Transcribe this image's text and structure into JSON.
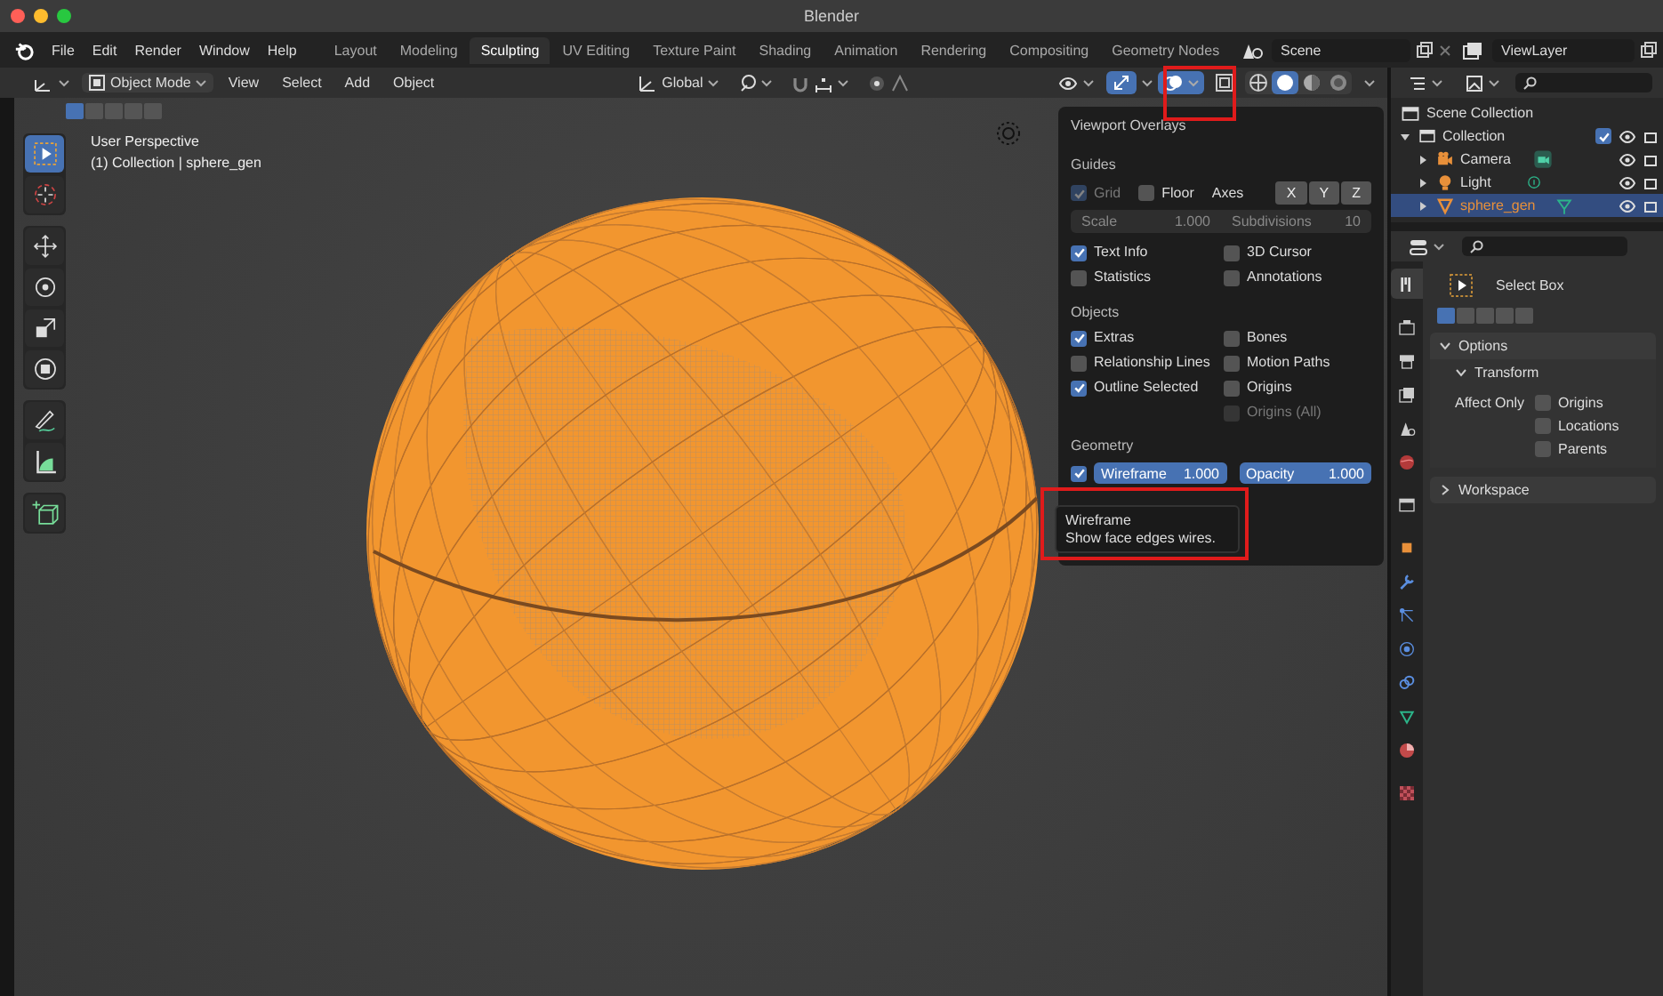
{
  "window": {
    "title": "Blender"
  },
  "menu": [
    "File",
    "Edit",
    "Render",
    "Window",
    "Help"
  ],
  "workspaces": [
    {
      "label": "Layout",
      "selected": false
    },
    {
      "label": "Modeling",
      "selected": false
    },
    {
      "label": "Sculpting",
      "selected": true
    },
    {
      "label": "UV Editing",
      "selected": false
    },
    {
      "label": "Texture Paint",
      "selected": false
    },
    {
      "label": "Shading",
      "selected": false
    },
    {
      "label": "Animation",
      "selected": false
    },
    {
      "label": "Rendering",
      "selected": false
    },
    {
      "label": "Compositing",
      "selected": false
    },
    {
      "label": "Geometry Nodes",
      "selected": false
    }
  ],
  "scene": {
    "name": "Scene"
  },
  "view_layer": {
    "name": "ViewLayer"
  },
  "header": {
    "mode": "Object Mode",
    "menus": [
      "View",
      "Select",
      "Add",
      "Object"
    ],
    "orientation": "Global",
    "gizmos_on": true,
    "overlays_on": true,
    "xray_on": false,
    "shading": [
      {
        "kind": "wireframe",
        "selected": false
      },
      {
        "kind": "solid",
        "selected": true
      },
      {
        "kind": "material",
        "selected": false
      },
      {
        "kind": "rendered",
        "selected": false
      }
    ]
  },
  "viewport": {
    "info": [
      "User Perspective",
      "(1) Collection | sphere_gen"
    ],
    "select_modes": [
      {
        "selected": true
      },
      {
        "selected": false
      },
      {
        "selected": false
      },
      {
        "selected": false
      },
      {
        "selected": false
      }
    ],
    "tool_groups": [
      [
        {
          "kind": "select_box",
          "selected": true
        },
        {
          "kind": "cursor",
          "selected": false
        }
      ],
      [
        {
          "kind": "move",
          "selected": false
        },
        {
          "kind": "rotate",
          "selected": false
        },
        {
          "kind": "scale",
          "selected": false
        },
        {
          "kind": "transform",
          "selected": false
        }
      ],
      [
        {
          "kind": "annotate",
          "selected": false
        },
        {
          "kind": "measure",
          "selected": false
        }
      ],
      [
        {
          "kind": "add_cube",
          "selected": false
        }
      ]
    ]
  },
  "overlays": {
    "title": "Viewport Overlays",
    "guides": {
      "heading": "Guides",
      "grid": {
        "label": "Grid",
        "checked": true,
        "disabled": true
      },
      "floor": {
        "label": "Floor",
        "checked": false,
        "disabled": false
      },
      "axes_label": "Axes",
      "axes": [
        "X",
        "Y",
        "Z"
      ],
      "scale": {
        "label": "Scale",
        "value": "1.000"
      },
      "subdivisions": {
        "label": "Subdivisions",
        "value": "10"
      },
      "options": [
        {
          "label": "Text Info",
          "checked": true,
          "disabled": false
        },
        {
          "label": "3D Cursor",
          "checked": false,
          "disabled": false
        },
        {
          "label": "Statistics",
          "checked": false,
          "disabled": false
        },
        {
          "label": "Annotations",
          "checked": false,
          "disabled": false
        }
      ]
    },
    "objects": {
      "heading": "Objects",
      "options": [
        {
          "label": "Extras",
          "checked": true,
          "disabled": false
        },
        {
          "label": "Bones",
          "checked": false,
          "disabled": false
        },
        {
          "label": "Relationship Lines",
          "checked": false,
          "disabled": false
        },
        {
          "label": "Motion Paths",
          "checked": false,
          "disabled": false
        },
        {
          "label": "Outline Selected",
          "checked": true,
          "disabled": false
        },
        {
          "label": "Origins",
          "checked": false,
          "disabled": false
        },
        {
          "label": "Origins (All)",
          "checked": false,
          "disabled": true
        }
      ]
    },
    "geometry": {
      "heading": "Geometry",
      "wireframe": {
        "checked": true,
        "label": "Wireframe",
        "value": "1.000",
        "level": 1
      },
      "opacity": {
        "label": "Opacity",
        "value": "1.000",
        "level": 1
      }
    }
  },
  "tooltip": {
    "title": "Wireframe",
    "text": "Show face edges wires."
  },
  "outliner": {
    "root": "Scene Collection",
    "items": [
      {
        "label": "Collection",
        "kind": "collection",
        "expanded": true,
        "checked": true,
        "selected": false,
        "children": [
          {
            "label": "Camera",
            "kind": "camera",
            "expanded": false,
            "selected": false
          },
          {
            "label": "Light",
            "kind": "light",
            "expanded": false,
            "selected": false
          },
          {
            "label": "sphere_gen",
            "kind": "mesh",
            "expanded": false,
            "selected": true
          }
        ]
      }
    ]
  },
  "properties": {
    "tabs": [
      {
        "kind": "tool",
        "selected": true
      },
      {
        "kind": "render",
        "selected": false
      },
      {
        "kind": "output",
        "selected": false
      },
      {
        "kind": "view_layer",
        "selected": false
      },
      {
        "kind": "scene",
        "selected": false
      },
      {
        "kind": "world",
        "selected": false
      },
      {
        "kind": "collection",
        "selected": false
      },
      {
        "kind": "object",
        "selected": false
      },
      {
        "kind": "modifiers",
        "selected": false
      },
      {
        "kind": "particles",
        "selected": false
      },
      {
        "kind": "physics",
        "selected": false
      },
      {
        "kind": "constraints",
        "selected": false
      },
      {
        "kind": "data",
        "selected": false
      },
      {
        "kind": "material",
        "selected": false
      },
      {
        "kind": "texture",
        "selected": false
      }
    ],
    "tool_name": "Select Box",
    "select_modes": [
      {
        "selected": true
      },
      {
        "selected": false
      },
      {
        "selected": false
      },
      {
        "selected": false
      },
      {
        "selected": false
      }
    ],
    "panels": [
      {
        "label": "Options",
        "expanded": true,
        "subpanels": [
          {
            "label": "Transform",
            "expanded": true,
            "field_label": "Affect Only",
            "options": [
              {
                "label": "Origins",
                "checked": false
              },
              {
                "label": "Locations",
                "checked": false
              },
              {
                "label": "Parents",
                "checked": false
              }
            ]
          }
        ]
      },
      {
        "label": "Workspace",
        "expanded": false
      }
    ]
  }
}
